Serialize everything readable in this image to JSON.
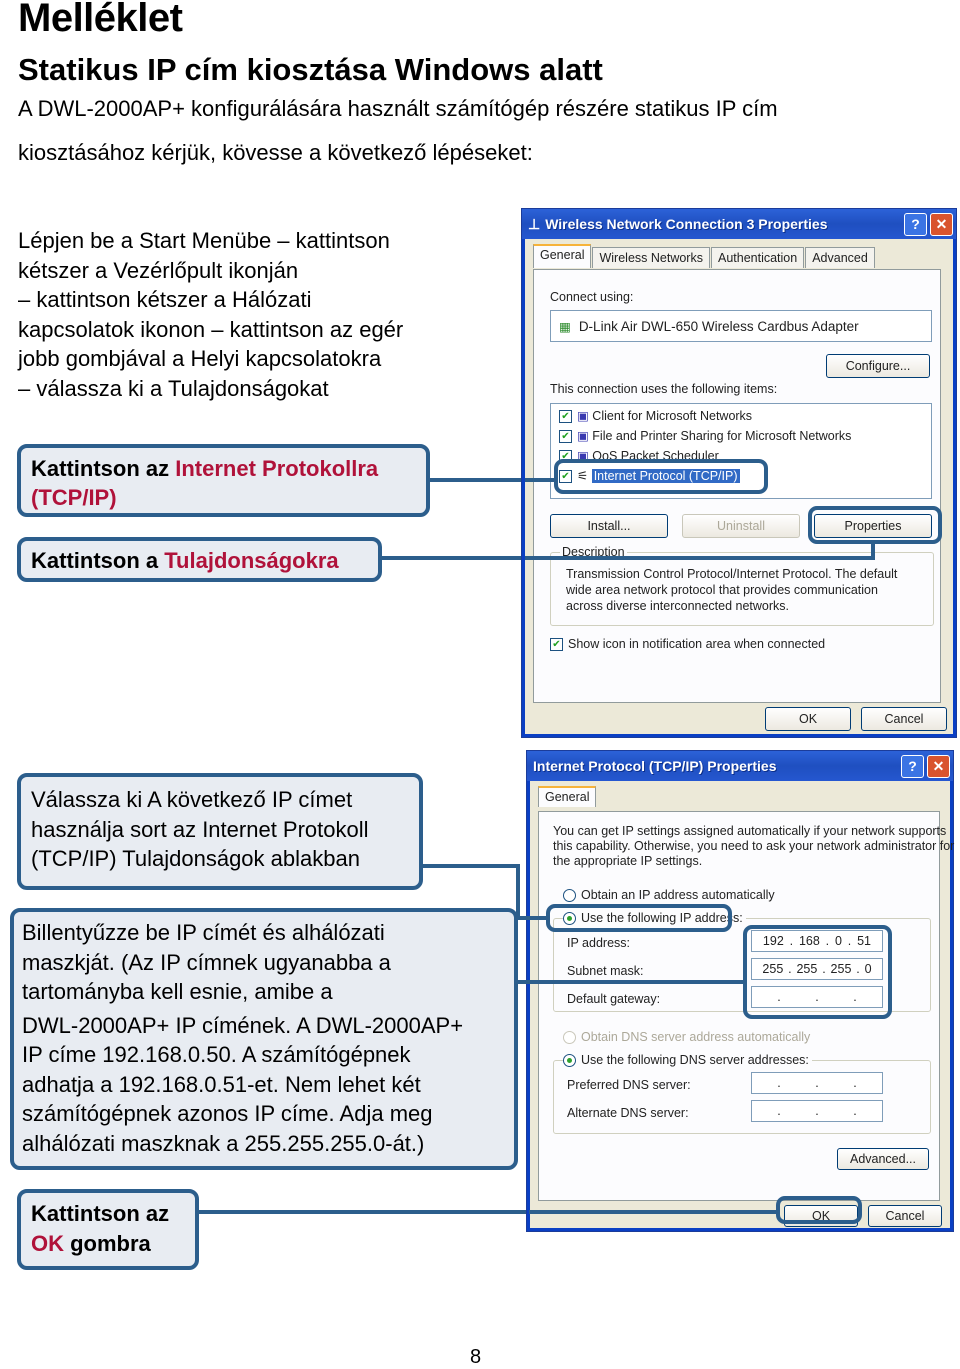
{
  "header": {
    "title": "Melléklet",
    "subtitle": "Statikus IP cím kiosztása Windows alatt",
    "intro_line1": "A DWL-2000AP+ konfigurálására használt számítógép részére statikus IP cím",
    "intro_line2": "kiosztásához kérjük, kövesse a következő lépéseket:"
  },
  "steps_text": [
    "Lépjen be a Start Menübe – kattintson",
    "kétszer a Vezérlőpult ikonján",
    "– kattintson kétszer a Hálózati",
    "kapcsolatok ikonon – kattintson az egér",
    "jobb gombjával a Helyi kapcsolatokra",
    "– válassza ki a Tulajdonságokat"
  ],
  "callouts": {
    "tcpip": {
      "prefix": "Kattintson az ",
      "highlight": "Internet Protokollra (TCP/IP)"
    },
    "properties": {
      "prefix": "Kattintson a ",
      "highlight": "Tulajdonságokra"
    },
    "use_ip": {
      "lines": [
        "Válassza ki A következő IP címet",
        "használja sort az Internet Protokoll",
        "(TCP/IP) Tulajdonságok ablakban"
      ]
    },
    "enter_ip": {
      "lines": [
        "Billentyűzze be IP címét és alhálózati",
        "maszkját. (Az IP címnek ugyanabba a",
        "tartományba kell esnie, amibe a",
        "DWL-2000AP+ IP címének. A DWL-2000AP+",
        "IP címe 192.168.0.50. A számítógépnek",
        "adhatja a 192.168.0.51-et. Nem lehet két",
        "számítógépnek azonos IP címe. Adja meg",
        "alhálózati maszknak a 255.255.255.0-át.)"
      ]
    },
    "ok": {
      "line1": "Kattintson az",
      "highlight": "OK",
      "suffix": " gombra"
    }
  },
  "colors": {
    "callout_border": "#2c5e8c",
    "callout_bg": "#e8ecf2",
    "highlight_red": "#b0123a"
  },
  "dialog1": {
    "title": "Wireless Network Connection 3 Properties",
    "tabs": [
      "General",
      "Wireless Networks",
      "Authentication",
      "Advanced"
    ],
    "active_tab": "General",
    "connect_using_label": "Connect using:",
    "adapter": "D-Link Air DWL-650 Wireless Cardbus Adapter",
    "configure_btn": "Configure...",
    "items_label": "This connection uses the following items:",
    "items": [
      {
        "label": "Client for Microsoft Networks",
        "checked": true
      },
      {
        "label": "File and Printer Sharing for Microsoft Networks",
        "checked": true
      },
      {
        "label": "QoS Packet Scheduler",
        "checked": true
      },
      {
        "label": "Internet Protocol (TCP/IP)",
        "checked": true,
        "selected": true
      }
    ],
    "install_btn": "Install...",
    "uninstall_btn": "Uninstall",
    "properties_btn": "Properties",
    "description_label": "Description",
    "description_lines": [
      "Transmission Control Protocol/Internet Protocol. The default",
      "wide area network protocol that provides communication",
      "across diverse interconnected networks."
    ],
    "show_icon_label": "Show icon in notification area when connected",
    "ok_btn": "OK",
    "cancel_btn": "Cancel"
  },
  "dialog2": {
    "title": "Internet Protocol (TCP/IP) Properties",
    "tab": "General",
    "info_lines": [
      "You can get IP settings assigned automatically if your network supports",
      "this capability. Otherwise, you need to ask your network administrator for",
      "the appropriate IP settings."
    ],
    "obtain_auto": "Obtain an IP address automatically",
    "use_following": "Use the following IP address:",
    "ip_label": "IP address:",
    "ip_value": [
      "192",
      "168",
      "0",
      "51"
    ],
    "subnet_label": "Subnet mask:",
    "subnet_value": [
      "255",
      "255",
      "255",
      "0"
    ],
    "gateway_label": "Default gateway:",
    "dns_auto": "Obtain DNS server address automatically",
    "dns_use": "Use the following DNS server addresses:",
    "pref_dns_label": "Preferred DNS server:",
    "alt_dns_label": "Alternate DNS server:",
    "advanced_btn": "Advanced...",
    "ok_btn": "OK",
    "cancel_btn": "Cancel"
  },
  "page_number": "8"
}
